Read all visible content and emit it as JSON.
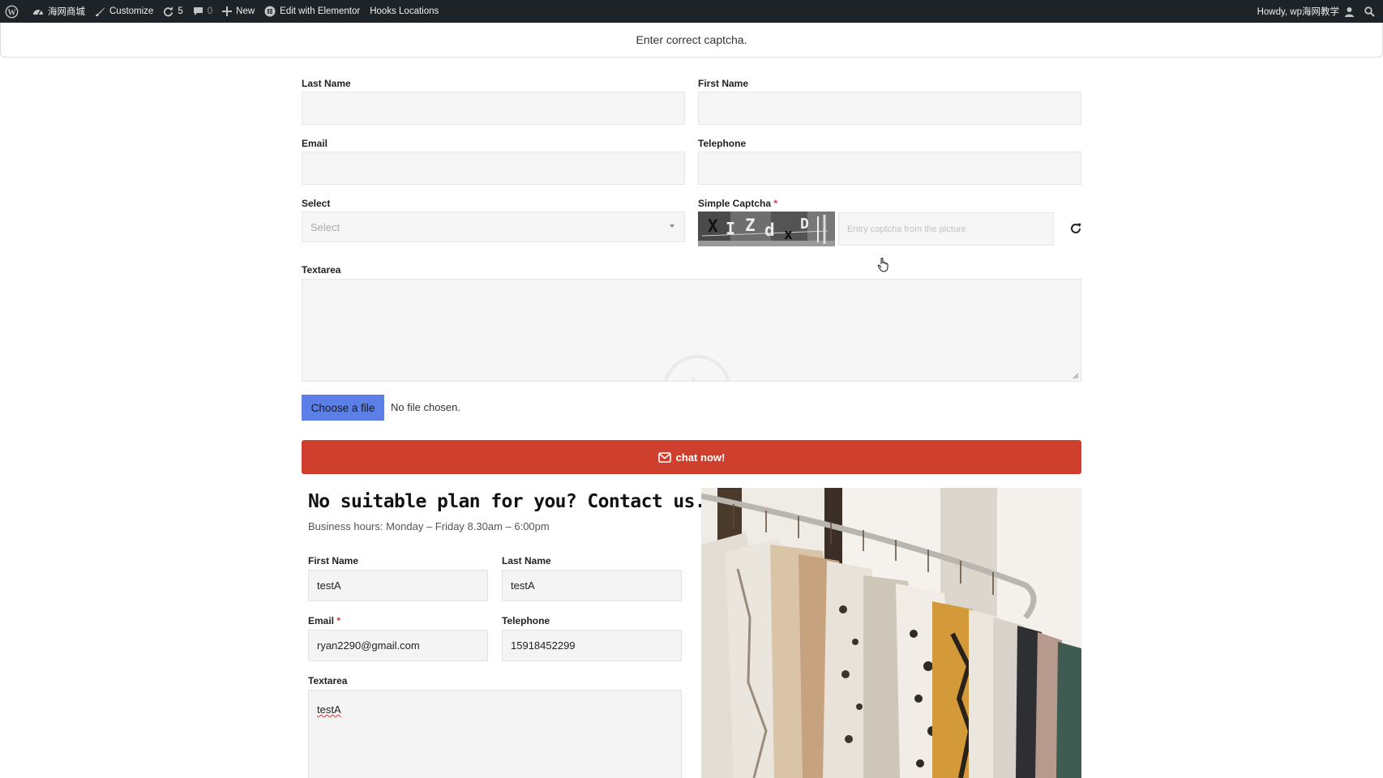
{
  "admin_bar": {
    "site_name": "海网商城",
    "customize": "Customize",
    "updates_count": "5",
    "comments_count": "0",
    "new_label": "New",
    "elementor_label": "Edit with Elementor",
    "hooks_label": "Hooks Locations",
    "howdy": "Howdy, wp海网教学"
  },
  "notice": {
    "text": "Enter correct captcha."
  },
  "form1": {
    "last_name_label": "Last Name",
    "first_name_label": "First Name",
    "email_label": "Email",
    "telephone_label": "Telephone",
    "select_label": "Select",
    "select_value": "Select",
    "captcha_label": "Simple Captcha",
    "captcha_required": "*",
    "captcha_chars": [
      "X",
      "I",
      "Z",
      "d",
      "x",
      "D"
    ],
    "captcha_placeholder": "Entry captcha from the picture",
    "textarea_label": "Textarea",
    "file_button": "Choose a file",
    "file_status": "No file chosen.",
    "submit_label": "chat now!"
  },
  "contact": {
    "heading": "No suitable plan for you? Contact us.",
    "hours": "Business hours: Monday – Friday 8.30am – 6:00pm",
    "first_name_label": "First Name",
    "first_name_value": "testA",
    "last_name_label": "Last Name",
    "last_name_value": "testA",
    "email_label": "Email",
    "email_required": "*",
    "email_value": "ryan2290@gmail.com",
    "telephone_label": "Telephone",
    "telephone_value": "15918452299",
    "textarea_label": "Textarea",
    "textarea_value": "testA"
  },
  "colors": {
    "admin_bar_bg": "#1d2327",
    "file_button_bg": "#5b7fe6",
    "submit_bg": "#cf3f2e",
    "required": "#d63638"
  }
}
